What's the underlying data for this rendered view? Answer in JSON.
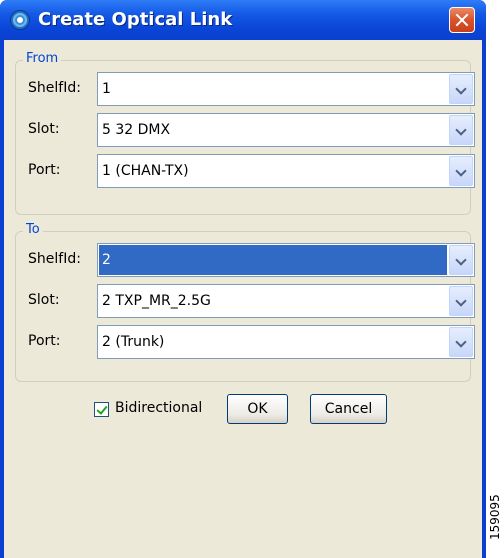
{
  "window": {
    "title": "Create Optical Link",
    "icon": "app-icon",
    "close_icon": "close-icon"
  },
  "from": {
    "legend": "From",
    "shelf_label": "ShelfId:",
    "shelf_value": "1",
    "slot_label": "Slot:",
    "slot_value": "5 32 DMX",
    "port_label": "Port:",
    "port_value": "1 (CHAN-TX)"
  },
  "to": {
    "legend": "To",
    "shelf_label": "ShelfId:",
    "shelf_value": "2",
    "slot_label": "Slot:",
    "slot_value": "2 TXP_MR_2.5G",
    "port_label": "Port:",
    "port_value": "2 (Trunk)"
  },
  "options": {
    "bidirectional_label": "Bidirectional",
    "bidirectional_checked": true
  },
  "buttons": {
    "ok_label": "OK",
    "cancel_label": "Cancel"
  },
  "figure_id": "159095",
  "colors": {
    "titlebar": "#0a46d8",
    "dialog_bg": "#ece9d8",
    "legend_text": "#0046d5",
    "selection": "#316ac5"
  }
}
